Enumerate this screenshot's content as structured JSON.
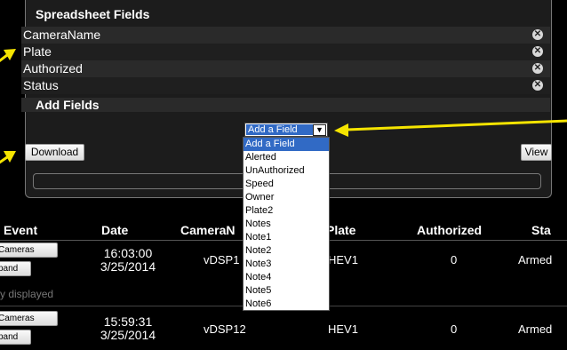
{
  "spreadsheet_fields": {
    "title": "Spreadsheet Fields",
    "fields": [
      {
        "label": "CameraName",
        "remove_icon": "x-circle-icon"
      },
      {
        "label": "Plate",
        "remove_icon": "x-circle-icon"
      },
      {
        "label": "Authorized",
        "remove_icon": "x-circle-icon"
      },
      {
        "label": "Status",
        "remove_icon": "x-circle-icon"
      }
    ]
  },
  "add_fields": {
    "label": "Add Fields",
    "select_value": "Add a Field",
    "options": [
      "Add a Field",
      "Alerted",
      "UnAuthorized",
      "Speed",
      "Owner",
      "Plate2",
      "Notes",
      "Note1",
      "Note2",
      "Note3",
      "Note4",
      "Note5",
      "Note6"
    ]
  },
  "buttons": {
    "download": "Download",
    "view": "View"
  },
  "table": {
    "columns": [
      "Event",
      "Date",
      "CameraN",
      "Plate",
      "Authorized",
      "Sta"
    ],
    "rows": [
      {
        "btn1": "Cameras",
        "btn2": "pand",
        "time": "16:03:00",
        "date": "3/25/2014",
        "camera": "vDSP1",
        "plate": "HEV1",
        "authorized": "0",
        "status": "Armed"
      },
      {
        "btn1": "Cameras",
        "btn2": "pand",
        "time": "15:59:31",
        "date": "3/25/2014",
        "camera": "vDSP12",
        "plate": "HEV1",
        "authorized": "0",
        "status": "Armed"
      }
    ],
    "note": "y displayed"
  },
  "colors": {
    "arrow": "#f5e400",
    "selection": "#316ac5"
  }
}
